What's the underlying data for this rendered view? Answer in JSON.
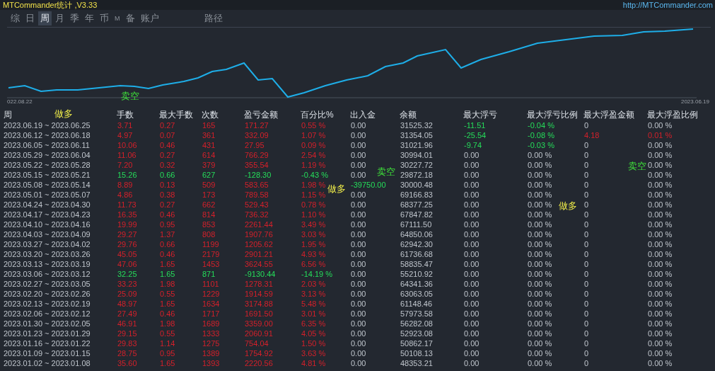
{
  "window": {
    "title": "MTCommander统计 ,V3.33",
    "link": "http://MTCommander.com"
  },
  "tabs": [
    {
      "label": "综",
      "selected": false
    },
    {
      "label": "日",
      "selected": false
    },
    {
      "label": "周",
      "selected": true
    },
    {
      "label": "月",
      "selected": false
    },
    {
      "label": "季",
      "selected": false
    },
    {
      "label": "年",
      "selected": false
    },
    {
      "label": "币",
      "selected": false
    },
    {
      "label": "M",
      "selected": false
    },
    {
      "label": "备",
      "selected": false
    },
    {
      "label": "账户",
      "selected": false
    },
    {
      "label": "路径",
      "selected": false
    }
  ],
  "chart": {
    "start_label": "022.08.22",
    "end_label": "2023.06.19"
  },
  "markers": [
    {
      "text": "卖空",
      "kind": "short"
    },
    {
      "text": "做多",
      "kind": "long"
    },
    {
      "text": "卖空",
      "kind": "short"
    },
    {
      "text": "卖空",
      "kind": "short"
    },
    {
      "text": "做多",
      "kind": "long"
    },
    {
      "text": "做多",
      "kind": "long"
    }
  ],
  "table": {
    "columns": [
      "周",
      "手数",
      "最大手数",
      "次数",
      "盈亏金额",
      "百分比%",
      "出入金",
      "余额",
      "最大浮亏",
      "最大浮亏比例",
      "最大浮盈金额",
      "最大浮盈比例"
    ],
    "rows": [
      {
        "cells": [
          "2023.06.19 ~ 2023.06.25",
          "3.71",
          "0.27",
          "165",
          "171.27",
          "0.55 %",
          "0.00",
          "31525.32",
          "-11.51",
          "-0.04 %",
          "0",
          "0.00 %"
        ],
        "loss": false,
        "flow_out": false,
        "float_loss": true,
        "float_gain": false
      },
      {
        "cells": [
          "2023.06.12 ~ 2023.06.18",
          "4.97",
          "0.07",
          "361",
          "332.09",
          "1.07 %",
          "0.00",
          "31354.05",
          "-25.54",
          "-0.08 %",
          "4.18",
          "0.01 %"
        ],
        "loss": false,
        "flow_out": false,
        "float_loss": true,
        "float_gain": true
      },
      {
        "cells": [
          "2023.06.05 ~ 2023.06.11",
          "10.06",
          "0.46",
          "431",
          "27.95",
          "0.09 %",
          "0.00",
          "31021.96",
          "-9.74",
          "-0.03 %",
          "0",
          "0.00 %"
        ],
        "loss": false,
        "flow_out": false,
        "float_loss": true,
        "float_gain": false
      },
      {
        "cells": [
          "2023.05.29 ~ 2023.06.04",
          "11.06",
          "0.27",
          "614",
          "766.29",
          "2.54 %",
          "0.00",
          "30994.01",
          "0.00",
          "0.00 %",
          "0",
          "0.00 %"
        ],
        "loss": false,
        "flow_out": false,
        "float_loss": false,
        "float_gain": false
      },
      {
        "cells": [
          "2023.05.22 ~ 2023.05.28",
          "7.20",
          "0.32",
          "379",
          "355.54",
          "1.19 %",
          "0.00",
          "30227.72",
          "0.00",
          "0.00 %",
          "0",
          "0.00 %"
        ],
        "loss": false,
        "flow_out": false,
        "float_loss": false,
        "float_gain": false
      },
      {
        "cells": [
          "2023.05.15 ~ 2023.05.21",
          "15.26",
          "0.66",
          "627",
          "-128.30",
          "-0.43 %",
          "0.00",
          "29872.18",
          "0.00",
          "0.00 %",
          "0",
          "0.00 %"
        ],
        "loss": true,
        "flow_out": false,
        "float_loss": false,
        "float_gain": false
      },
      {
        "cells": [
          "2023.05.08 ~ 2023.05.14",
          "8.89",
          "0.13",
          "509",
          "583.65",
          "1.98 %",
          "-39750.00",
          "30000.48",
          "0.00",
          "0.00 %",
          "0",
          "0.00 %"
        ],
        "loss": false,
        "flow_out": true,
        "float_loss": false,
        "float_gain": false
      },
      {
        "cells": [
          "2023.05.01 ~ 2023.05.07",
          "4.86",
          "0.38",
          "173",
          "789.58",
          "1.15 %",
          "0.00",
          "69166.83",
          "0.00",
          "0.00 %",
          "0",
          "0.00 %"
        ],
        "loss": false,
        "flow_out": false,
        "float_loss": false,
        "float_gain": false
      },
      {
        "cells": [
          "2023.04.24 ~ 2023.04.30",
          "11.73",
          "0.27",
          "662",
          "529.43",
          "0.78 %",
          "0.00",
          "68377.25",
          "0.00",
          "0.00 %",
          "0",
          "0.00 %"
        ],
        "loss": false,
        "flow_out": false,
        "float_loss": false,
        "float_gain": false
      },
      {
        "cells": [
          "2023.04.17 ~ 2023.04.23",
          "16.35",
          "0.46",
          "814",
          "736.32",
          "1.10 %",
          "0.00",
          "67847.82",
          "0.00",
          "0.00 %",
          "0",
          "0.00 %"
        ],
        "loss": false,
        "flow_out": false,
        "float_loss": false,
        "float_gain": false
      },
      {
        "cells": [
          "2023.04.10 ~ 2023.04.16",
          "19.99",
          "0.95",
          "853",
          "2261.44",
          "3.49 %",
          "0.00",
          "67111.50",
          "0.00",
          "0.00 %",
          "0",
          "0.00 %"
        ],
        "loss": false,
        "flow_out": false,
        "float_loss": false,
        "float_gain": false
      },
      {
        "cells": [
          "2023.04.03 ~ 2023.04.09",
          "29.27",
          "1.37",
          "808",
          "1907.76",
          "3.03 %",
          "0.00",
          "64850.06",
          "0.00",
          "0.00 %",
          "0",
          "0.00 %"
        ],
        "loss": false,
        "flow_out": false,
        "float_loss": false,
        "float_gain": false
      },
      {
        "cells": [
          "2023.03.27 ~ 2023.04.02",
          "29.76",
          "0.66",
          "1199",
          "1205.62",
          "1.95 %",
          "0.00",
          "62942.30",
          "0.00",
          "0.00 %",
          "0",
          "0.00 %"
        ],
        "loss": false,
        "flow_out": false,
        "float_loss": false,
        "float_gain": false
      },
      {
        "cells": [
          "2023.03.20 ~ 2023.03.26",
          "45.05",
          "0.46",
          "2179",
          "2901.21",
          "4.93 %",
          "0.00",
          "61736.68",
          "0.00",
          "0.00 %",
          "0",
          "0.00 %"
        ],
        "loss": false,
        "flow_out": false,
        "float_loss": false,
        "float_gain": false
      },
      {
        "cells": [
          "2023.03.13 ~ 2023.03.19",
          "47.06",
          "1.65",
          "1453",
          "3624.55",
          "6.56 %",
          "0.00",
          "58835.47",
          "0.00",
          "0.00 %",
          "0",
          "0.00 %"
        ],
        "loss": false,
        "flow_out": false,
        "float_loss": false,
        "float_gain": false
      },
      {
        "cells": [
          "2023.03.06 ~ 2023.03.12",
          "32.25",
          "1.65",
          "871",
          "-9130.44",
          "-14.19 %",
          "0.00",
          "55210.92",
          "0.00",
          "0.00 %",
          "0",
          "0.00 %"
        ],
        "loss": true,
        "flow_out": false,
        "float_loss": false,
        "float_gain": false
      },
      {
        "cells": [
          "2023.02.27 ~ 2023.03.05",
          "33.23",
          "1.98",
          "1101",
          "1278.31",
          "2.03 %",
          "0.00",
          "64341.36",
          "0.00",
          "0.00 %",
          "0",
          "0.00 %"
        ],
        "loss": false,
        "flow_out": false,
        "float_loss": false,
        "float_gain": false
      },
      {
        "cells": [
          "2023.02.20 ~ 2023.02.26",
          "25.09",
          "0.55",
          "1229",
          "1914.59",
          "3.13 %",
          "0.00",
          "63063.05",
          "0.00",
          "0.00 %",
          "0",
          "0.00 %"
        ],
        "loss": false,
        "flow_out": false,
        "float_loss": false,
        "float_gain": false
      },
      {
        "cells": [
          "2023.02.13 ~ 2023.02.19",
          "48.97",
          "1.65",
          "1634",
          "3174.88",
          "5.48 %",
          "0.00",
          "61148.46",
          "0.00",
          "0.00 %",
          "0",
          "0.00 %"
        ],
        "loss": false,
        "flow_out": false,
        "float_loss": false,
        "float_gain": false
      },
      {
        "cells": [
          "2023.02.06 ~ 2023.02.12",
          "27.49",
          "0.46",
          "1717",
          "1691.50",
          "3.01 %",
          "0.00",
          "57973.58",
          "0.00",
          "0.00 %",
          "0",
          "0.00 %"
        ],
        "loss": false,
        "flow_out": false,
        "float_loss": false,
        "float_gain": false
      },
      {
        "cells": [
          "2023.01.30 ~ 2023.02.05",
          "46.91",
          "1.98",
          "1689",
          "3359.00",
          "6.35 %",
          "0.00",
          "56282.08",
          "0.00",
          "0.00 %",
          "0",
          "0.00 %"
        ],
        "loss": false,
        "flow_out": false,
        "float_loss": false,
        "float_gain": false
      },
      {
        "cells": [
          "2023.01.23 ~ 2023.01.29",
          "29.15",
          "0.55",
          "1333",
          "2060.91",
          "4.05 %",
          "0.00",
          "52923.08",
          "0.00",
          "0.00 %",
          "0",
          "0.00 %"
        ],
        "loss": false,
        "flow_out": false,
        "float_loss": false,
        "float_gain": false
      },
      {
        "cells": [
          "2023.01.16 ~ 2023.01.22",
          "29.83",
          "1.14",
          "1275",
          "754.04",
          "1.50 %",
          "0.00",
          "50862.17",
          "0.00",
          "0.00 %",
          "0",
          "0.00 %"
        ],
        "loss": false,
        "flow_out": false,
        "float_loss": false,
        "float_gain": false
      },
      {
        "cells": [
          "2023.01.09 ~ 2023.01.15",
          "28.75",
          "0.95",
          "1389",
          "1754.92",
          "3.63 %",
          "0.00",
          "50108.13",
          "0.00",
          "0.00 %",
          "0",
          "0.00 %"
        ],
        "loss": false,
        "flow_out": false,
        "float_loss": false,
        "float_gain": false
      },
      {
        "cells": [
          "2023.01.02 ~ 2023.01.08",
          "35.60",
          "1.65",
          "1393",
          "2220.56",
          "4.81 %",
          "0.00",
          "48353.21",
          "0.00",
          "0.00 %",
          "0",
          "0.00 %"
        ],
        "loss": false,
        "flow_out": false,
        "float_loss": false,
        "float_gain": false
      }
    ]
  }
}
